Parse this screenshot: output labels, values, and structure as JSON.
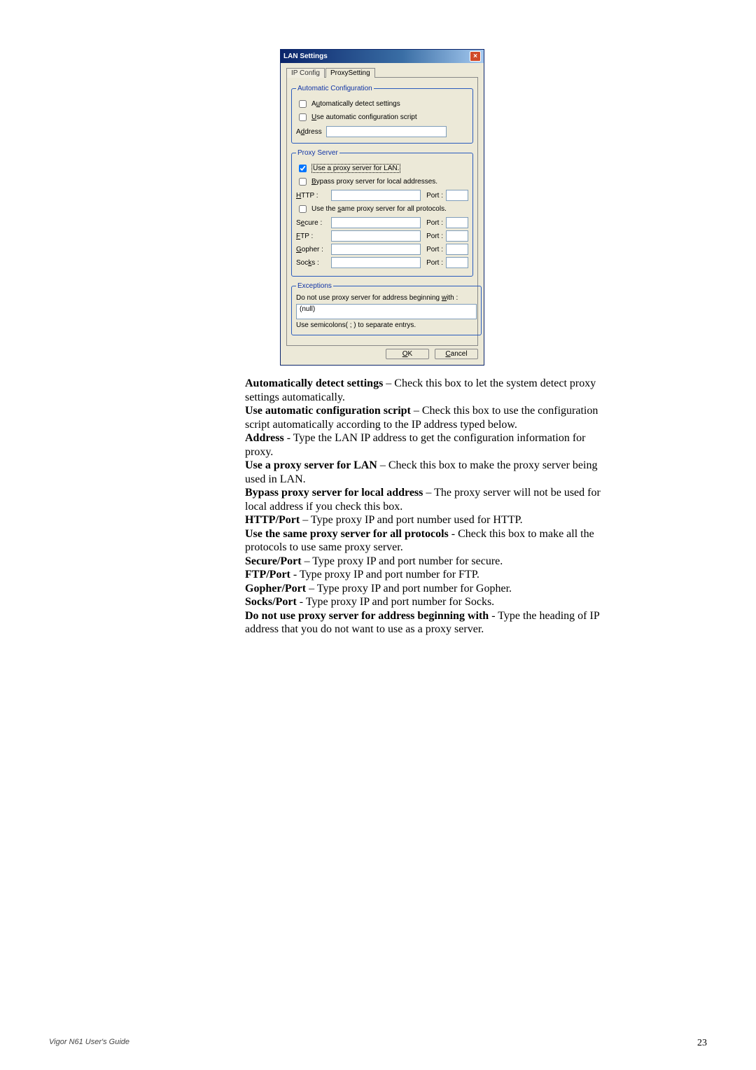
{
  "dialog": {
    "title": "LAN Settings",
    "close_glyph": "×",
    "tabs": {
      "ip_config": "IP Config",
      "proxy_setting": "ProxySetting"
    },
    "auto_config": {
      "legend": "Automatic Configuration",
      "auto_detect": "Automatically detect settings",
      "use_script": "Use automatic configuration script",
      "address_label": "Address"
    },
    "proxy_server": {
      "legend": "Proxy Server",
      "use_proxy": "Use a proxy server for LAN.",
      "bypass_local": "Bypass proxy server for local addresses.",
      "http_label": "HTTP :",
      "port_label": "Port :",
      "same_proxy": "Use the same proxy server for all protocols.",
      "secure_label": "Secure :",
      "ftp_label": "FTP :",
      "gopher_label": "Gopher :",
      "socks_label": "Socks :"
    },
    "exceptions": {
      "legend": "Exceptions",
      "heading": "Do not use proxy server for address beginning with :",
      "value": "(null)",
      "hint": "Use semicolons( ; ) to separate entrys."
    },
    "buttons": {
      "ok": "OK",
      "cancel": "Cancel"
    }
  },
  "doc": {
    "p1a": "Automatically detect settings",
    "p1b": " – Check this box to let the system detect proxy settings automatically.",
    "p2a": "Use automatic configuration script",
    "p2b": " – Check this box to use the configuration script automatically according to the IP address typed below.",
    "p3a": "Address",
    "p3b": " - Type the LAN IP address to get the configuration information for proxy.",
    "p4a": "Use a proxy server for LAN",
    "p4b": " – Check this box to make the proxy server being used in LAN.",
    "p5a": "Bypass proxy server for local address",
    "p5b": " – The proxy server will not be used for local address if you check this box.",
    "p6a": "HTTP/Port",
    "p6b": " – Type proxy IP and port number used for HTTP.",
    "p7a": "Use the same proxy server for all protocols",
    "p7b": " - Check this box to make all the protocols to use same proxy server.",
    "p8a": "Secure/Port",
    "p8b": " – Type proxy IP and port number for secure.",
    "p9a": "FTP/Port",
    "p9b": " - Type proxy IP and port number for FTP.",
    "p10a": "Gopher/Port",
    "p10b": " – Type proxy IP and port number for Gopher.",
    "p11a": "Socks/Port",
    "p11b": " - Type proxy IP and port number for Socks.",
    "p12a": "Do not use proxy server for address beginning with",
    "p12b": " - Type the heading of IP address that you do not want to use as a proxy server."
  },
  "footer": {
    "guide": "Vigor N61 User's Guide",
    "page": "23"
  }
}
